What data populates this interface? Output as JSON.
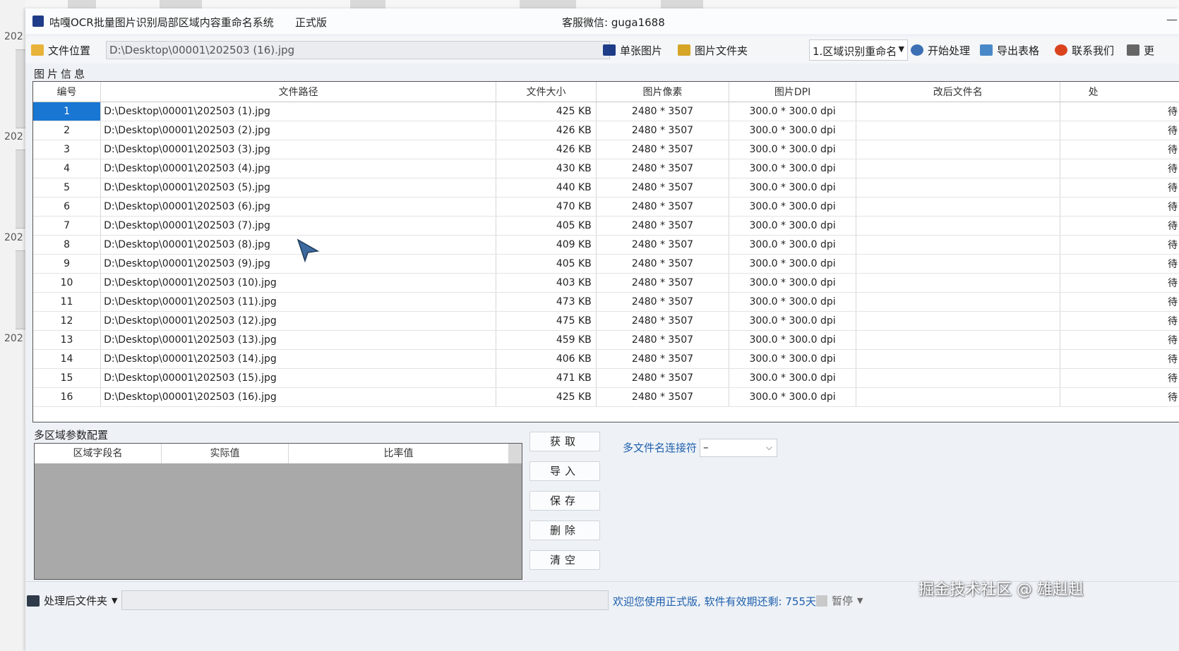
{
  "desktop": {
    "year_labels": [
      "202",
      "202",
      "202",
      "202"
    ]
  },
  "window": {
    "title": "咕嘎OCR批量图片识别局部区域内容重命名系统",
    "edition": "正式版",
    "service": "客服微信: guga1688"
  },
  "toolbar": {
    "file_location_label": "文件位置",
    "path_value": "D:\\Desktop\\00001\\202503 (16).jpg",
    "single_image_label": "单张图片",
    "image_folder_label": "图片文件夹",
    "mode_value": "1.区域识别重命名",
    "start_label": "开始处理",
    "export_label": "导出表格",
    "contact_label": "联系我们",
    "more_label": "更"
  },
  "section_label": "图片信息",
  "table": {
    "columns": [
      "编号",
      "文件路径",
      "文件大小",
      "图片像素",
      "图片DPI",
      "改后文件名",
      "处"
    ],
    "rows": [
      {
        "num": "1",
        "path": "D:\\Desktop\\00001\\202503 (1).jpg",
        "size": "425 KB",
        "px": "2480 * 3507",
        "dpi": "300.0 * 300.0 dpi",
        "renamed": "",
        "status": "待"
      },
      {
        "num": "2",
        "path": "D:\\Desktop\\00001\\202503 (2).jpg",
        "size": "426 KB",
        "px": "2480 * 3507",
        "dpi": "300.0 * 300.0 dpi",
        "renamed": "",
        "status": "待"
      },
      {
        "num": "3",
        "path": "D:\\Desktop\\00001\\202503 (3).jpg",
        "size": "426 KB",
        "px": "2480 * 3507",
        "dpi": "300.0 * 300.0 dpi",
        "renamed": "",
        "status": "待"
      },
      {
        "num": "4",
        "path": "D:\\Desktop\\00001\\202503 (4).jpg",
        "size": "430 KB",
        "px": "2480 * 3507",
        "dpi": "300.0 * 300.0 dpi",
        "renamed": "",
        "status": "待"
      },
      {
        "num": "5",
        "path": "D:\\Desktop\\00001\\202503 (5).jpg",
        "size": "440 KB",
        "px": "2480 * 3507",
        "dpi": "300.0 * 300.0 dpi",
        "renamed": "",
        "status": "待"
      },
      {
        "num": "6",
        "path": "D:\\Desktop\\00001\\202503 (6).jpg",
        "size": "470 KB",
        "px": "2480 * 3507",
        "dpi": "300.0 * 300.0 dpi",
        "renamed": "",
        "status": "待"
      },
      {
        "num": "7",
        "path": "D:\\Desktop\\00001\\202503 (7).jpg",
        "size": "405 KB",
        "px": "2480 * 3507",
        "dpi": "300.0 * 300.0 dpi",
        "renamed": "",
        "status": "待"
      },
      {
        "num": "8",
        "path": "D:\\Desktop\\00001\\202503 (8).jpg",
        "size": "409 KB",
        "px": "2480 * 3507",
        "dpi": "300.0 * 300.0 dpi",
        "renamed": "",
        "status": "待"
      },
      {
        "num": "9",
        "path": "D:\\Desktop\\00001\\202503 (9).jpg",
        "size": "405 KB",
        "px": "2480 * 3507",
        "dpi": "300.0 * 300.0 dpi",
        "renamed": "",
        "status": "待"
      },
      {
        "num": "10",
        "path": "D:\\Desktop\\00001\\202503 (10).jpg",
        "size": "403 KB",
        "px": "2480 * 3507",
        "dpi": "300.0 * 300.0 dpi",
        "renamed": "",
        "status": "待"
      },
      {
        "num": "11",
        "path": "D:\\Desktop\\00001\\202503 (11).jpg",
        "size": "473 KB",
        "px": "2480 * 3507",
        "dpi": "300.0 * 300.0 dpi",
        "renamed": "",
        "status": "待"
      },
      {
        "num": "12",
        "path": "D:\\Desktop\\00001\\202503 (12).jpg",
        "size": "475 KB",
        "px": "2480 * 3507",
        "dpi": "300.0 * 300.0 dpi",
        "renamed": "",
        "status": "待"
      },
      {
        "num": "13",
        "path": "D:\\Desktop\\00001\\202503 (13).jpg",
        "size": "459 KB",
        "px": "2480 * 3507",
        "dpi": "300.0 * 300.0 dpi",
        "renamed": "",
        "status": "待"
      },
      {
        "num": "14",
        "path": "D:\\Desktop\\00001\\202503 (14).jpg",
        "size": "406 KB",
        "px": "2480 * 3507",
        "dpi": "300.0 * 300.0 dpi",
        "renamed": "",
        "status": "待"
      },
      {
        "num": "15",
        "path": "D:\\Desktop\\00001\\202503 (15).jpg",
        "size": "471 KB",
        "px": "2480 * 3507",
        "dpi": "300.0 * 300.0 dpi",
        "renamed": "",
        "status": "待"
      },
      {
        "num": "16",
        "path": "D:\\Desktop\\00001\\202503 (16).jpg",
        "size": "425 KB",
        "px": "2480 * 3507",
        "dpi": "300.0 * 300.0 dpi",
        "renamed": "",
        "status": "待"
      }
    ],
    "selected_row": 1
  },
  "config": {
    "label": "多区域参数配置",
    "columns": [
      "区域字段名",
      "实际值",
      "比率值"
    ],
    "buttons": [
      "获取",
      "导入",
      "保存",
      "删除",
      "清空"
    ],
    "joiner_label": "多文件名连接符",
    "joiner_value": "–"
  },
  "status": {
    "output_folder_label": "处理后文件夹",
    "welcome": "欢迎您使用正式版, 软件有效期还剩: 755天",
    "pause_label": "暂停"
  },
  "watermark": "掘金技术社区 @ 雄赳赳",
  "colors": {
    "selection": "#1976d2",
    "link_blue": "#1f5fae",
    "brand": "#1f3c88"
  }
}
